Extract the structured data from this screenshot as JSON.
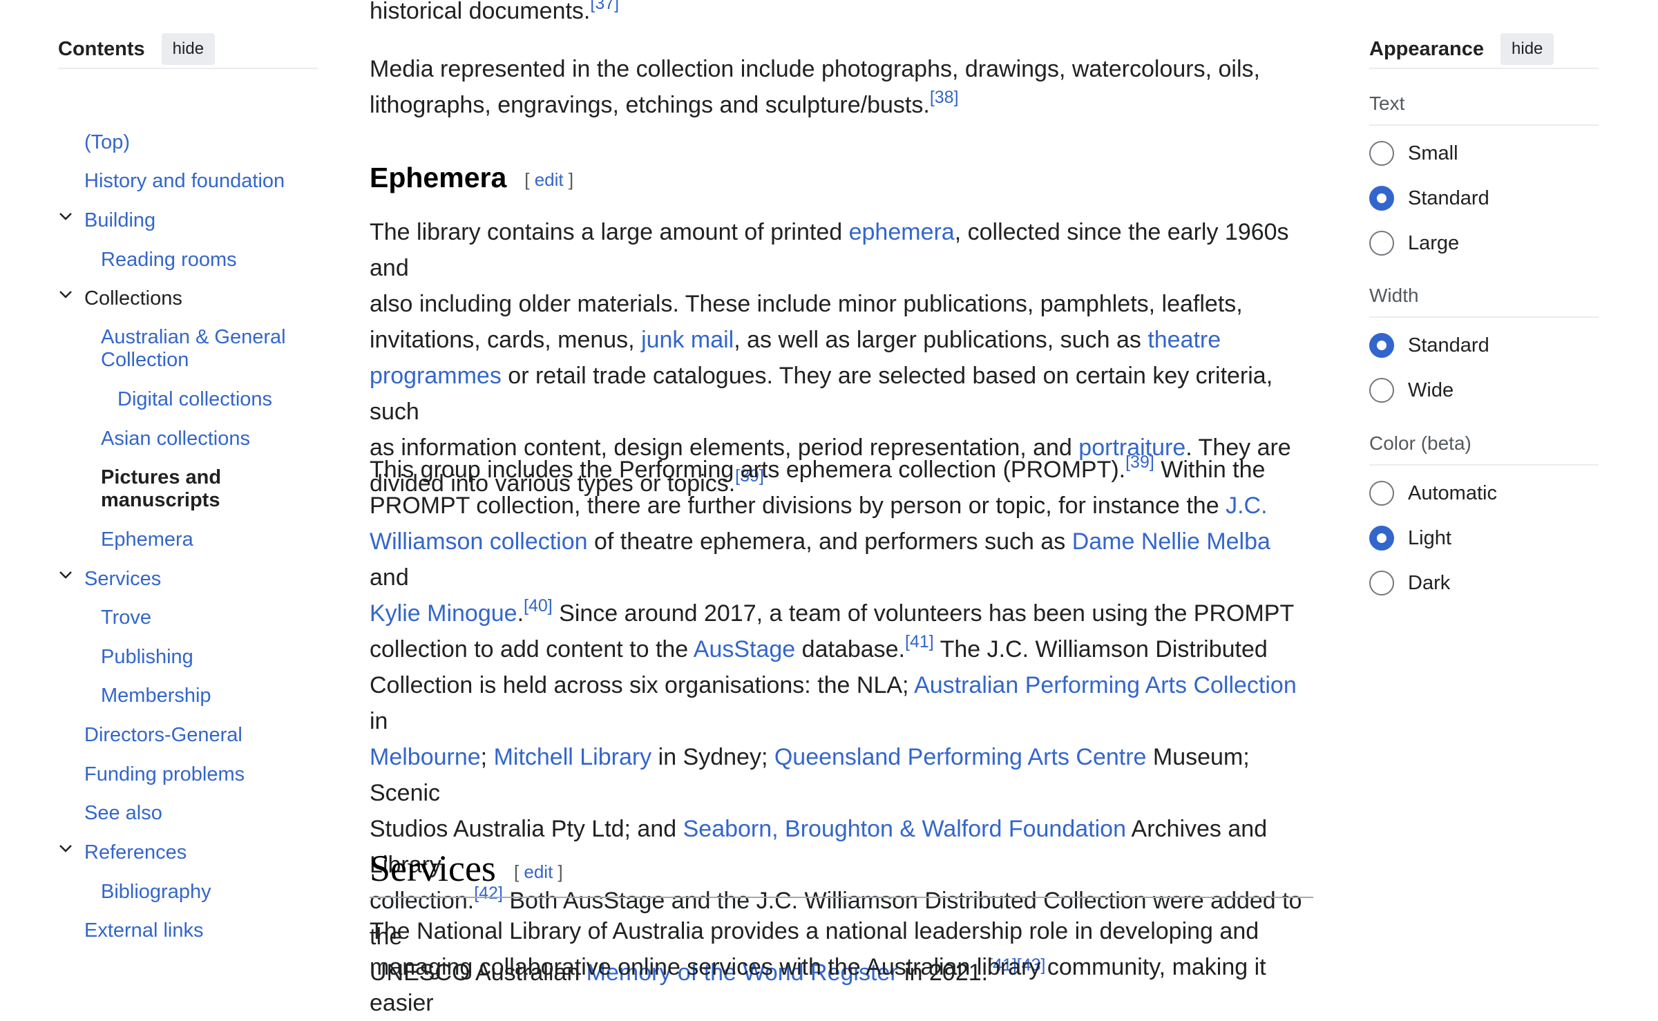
{
  "toc": {
    "title": "Contents",
    "hide_label": "hide",
    "items": [
      {
        "label": "(Top)"
      },
      {
        "label": "History and foundation"
      },
      {
        "label": "Building"
      },
      {
        "label": "Reading rooms"
      },
      {
        "label": "Collections"
      },
      {
        "label": "Australian & General Collection"
      },
      {
        "label": "Digital collections"
      },
      {
        "label": "Asian collections"
      },
      {
        "label": "Pictures and manuscripts"
      },
      {
        "label": "Ephemera"
      },
      {
        "label": "Services"
      },
      {
        "label": "Trove"
      },
      {
        "label": "Publishing"
      },
      {
        "label": "Membership"
      },
      {
        "label": "Directors-General"
      },
      {
        "label": "Funding problems"
      },
      {
        "label": "See also"
      },
      {
        "label": "References"
      },
      {
        "label": "Bibliography"
      },
      {
        "label": "External links"
      }
    ]
  },
  "article": {
    "top_fragment": "historical documents.",
    "top_ref": "[37]",
    "media_para": {
      "text1": "Media represented in the collection include photographs, drawings, watercolours, oils,",
      "text2": "lithographs, engravings, etchings and sculpture/busts.",
      "ref": "[38]"
    },
    "ephemera_heading": "Ephemera",
    "edit_label": "edit",
    "ephemera_para1": {
      "t1": "The library contains a large amount of printed ",
      "l1": "ephemera",
      "t2": ", collected since the early 1960s and",
      "t3": "also including older materials. These include minor publications, pamphlets, leaflets,",
      "t4": "invitations, cards, menus, ",
      "l2": "junk mail",
      "t5": ", as well as larger publications, such as ",
      "l3a": "theatre",
      "l3b": "programmes",
      "t6": " or retail trade catalogues. They are selected based on certain key criteria, such",
      "t7": "as information content, design elements, period representation, and ",
      "l4": "portraiture",
      "t8": ". They are",
      "t9": "divided into various types or topics.",
      "ref": "[39]"
    },
    "ephemera_para2": {
      "a1": "This group includes the Performing arts ephemera collection (PROMPT).",
      "r1": "[39]",
      "a2": " Within the",
      "b1": "PROMPT collection, there are further divisions by person or topic, for instance the ",
      "bl": "J.C.",
      "cl": "Williamson collection",
      "c1": " of theatre ephemera, and performers such as ",
      "cl2": "Dame Nellie Melba",
      "c2": " and",
      "dl": "Kylie Minogue",
      "d1": ".",
      "r2": "[40]",
      "d2": " Since around 2017, a team of volunteers has been using the PROMPT",
      "e1": "collection to add content to the ",
      "el": "AusStage",
      "e2": " database.",
      "r3": "[41]",
      "e3": " The J.C. Williamson Distributed",
      "f1": "Collection is held across six organisations: the NLA; ",
      "fl": "Australian Performing Arts Collection",
      "f2": " in",
      "gl1": "Melbourne",
      "g1": "; ",
      "gl2": "Mitchell Library",
      "g2": " in Sydney; ",
      "gl3": "Queensland Performing Arts Centre",
      "g3": " Museum; Scenic",
      "h1": "Studios Australia Pty Ltd; and ",
      "hl": "Seaborn, Broughton & Walford Foundation",
      "h2": " Archives and Library",
      "i1": "collection.",
      "r4": "[42]",
      "i2": " Both AusStage and the J.C. Williamson Distributed Collection were added to the",
      "j1": "UNESCO Australian ",
      "jl": "Memory of the World Register",
      "j2": " in 2021.",
      "r5": "[41]",
      "r6": "[43]"
    },
    "services_heading": "Services",
    "services_para": {
      "t1": "The National Library of Australia provides a national leadership role in developing and",
      "t2": "managing collaborative online services with the Australian library community, making it easier"
    }
  },
  "appearance": {
    "title": "Appearance",
    "hide_label": "hide",
    "text_group": {
      "label": "Text",
      "options": [
        "Small",
        "Standard",
        "Large"
      ],
      "selected": "Standard"
    },
    "width_group": {
      "label": "Width",
      "options": [
        "Standard",
        "Wide"
      ],
      "selected": "Standard"
    },
    "color_group": {
      "label": "Color (beta)",
      "options": [
        "Automatic",
        "Light",
        "Dark"
      ],
      "selected": "Light"
    }
  }
}
